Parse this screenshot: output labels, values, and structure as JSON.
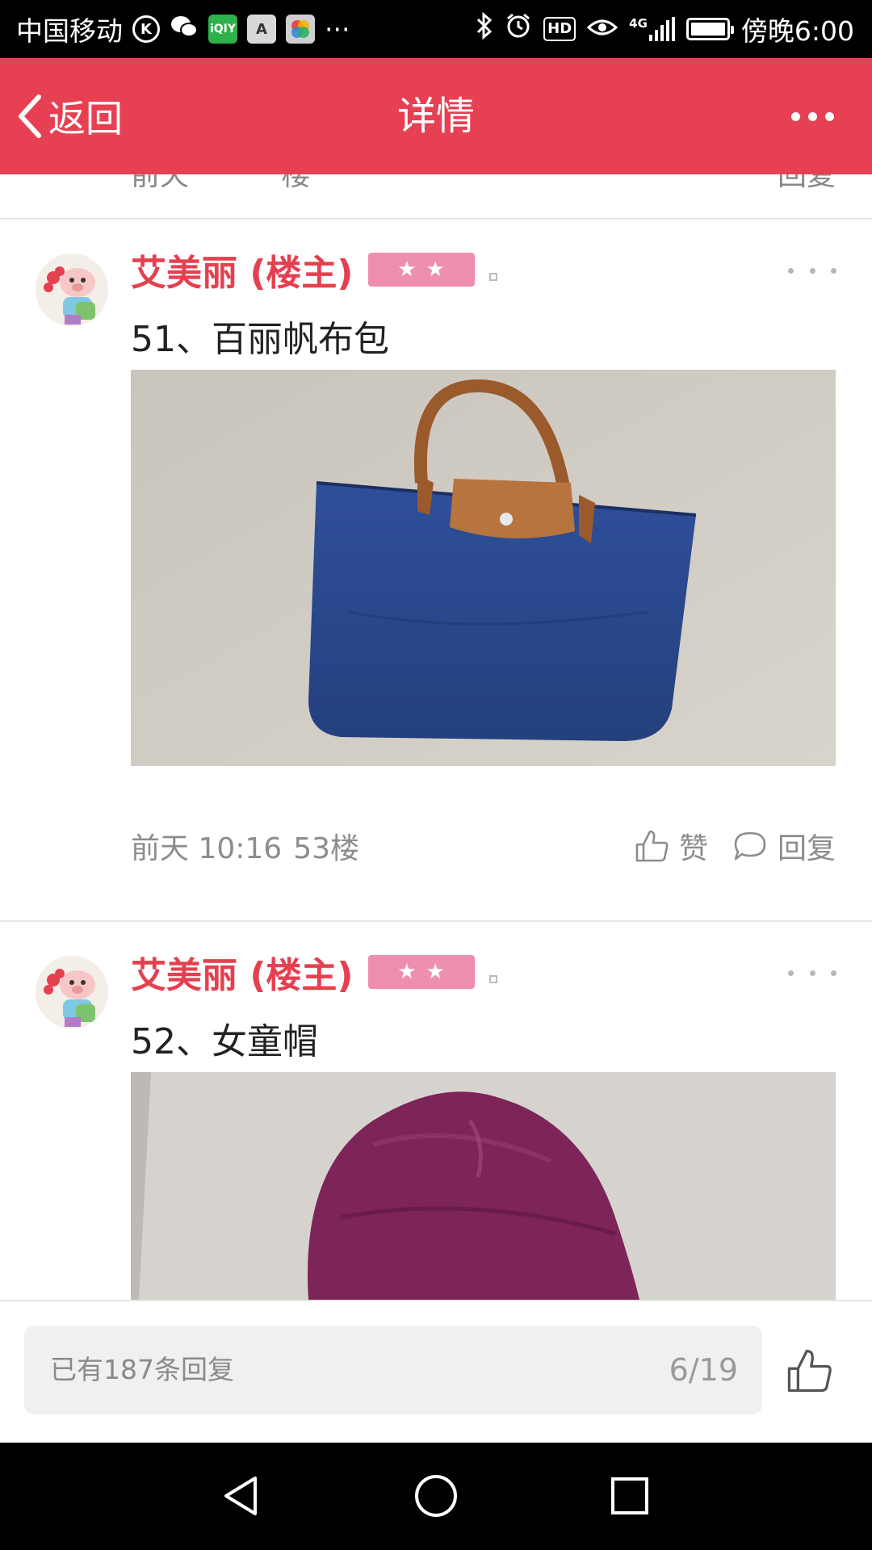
{
  "status_bar": {
    "carrier": "中国移动",
    "time": "傍晚6:00",
    "hd_label": "HD",
    "network_label": "4G",
    "app_icons": [
      "k-icon",
      "wechat-icon",
      "iqiyi-icon",
      "a-icon",
      "photos-icon"
    ],
    "more_label": "···"
  },
  "header": {
    "back_label": "返回",
    "title": "详情",
    "accent_color": "#e74053"
  },
  "partial_post": {
    "meta_text": "前天",
    "floor_text": "楼",
    "reply_text": "回复"
  },
  "posts": [
    {
      "author": "艾美丽 (楼主)",
      "badge_stars": 2,
      "text": "51、百丽帆布包",
      "image": "navy-canvas-tote-bag-photo",
      "time": "前天 10:16",
      "floor": "53楼",
      "like_label": "赞",
      "reply_label": "回复"
    },
    {
      "author": "艾美丽 (楼主)",
      "badge_stars": 2,
      "text": "52、女童帽",
      "image": "purple-girls-hat-photo"
    }
  ],
  "bottom_bar": {
    "reply_placeholder": "已有187条回复",
    "page_indicator": "6/19"
  }
}
